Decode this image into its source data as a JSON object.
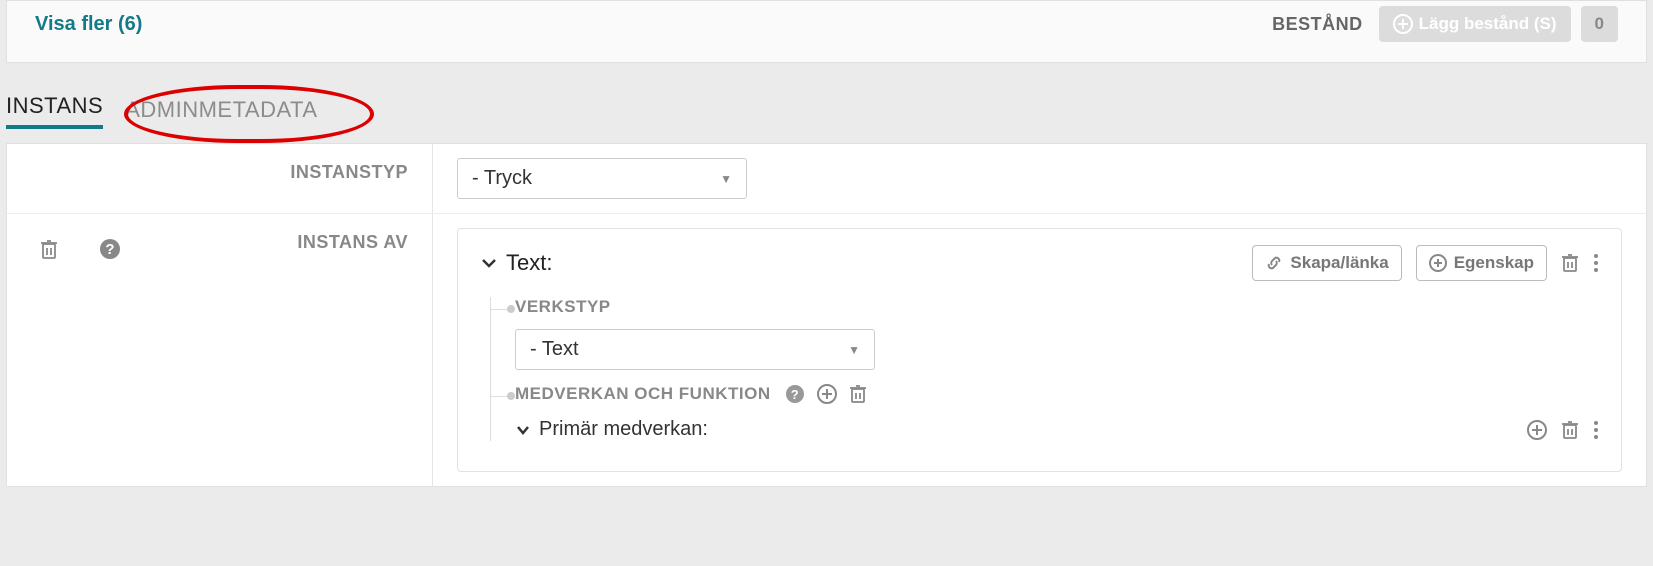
{
  "top": {
    "show_more": "Visa fler (6)",
    "bestand_label": "BESTÅND",
    "add_bestand": "Lägg bestånd (S)",
    "count": "0"
  },
  "tabs": {
    "instans": "INSTANS",
    "adminmetadata": "ADMINMETADATA"
  },
  "fields": {
    "instanstyp_label": "INSTANSTYP",
    "instanstyp_value": "- Tryck",
    "instans_av_label": "INSTANS AV"
  },
  "card": {
    "title": "Text:",
    "link_btn": "Skapa/länka",
    "prop_btn": "Egenskap",
    "verkstyp_label": "VERKSTYP",
    "verkstyp_value": "- Text",
    "medverkan_label": "MEDVERKAN OCH FUNKTION",
    "primar_label": "Primär medverkan:"
  }
}
